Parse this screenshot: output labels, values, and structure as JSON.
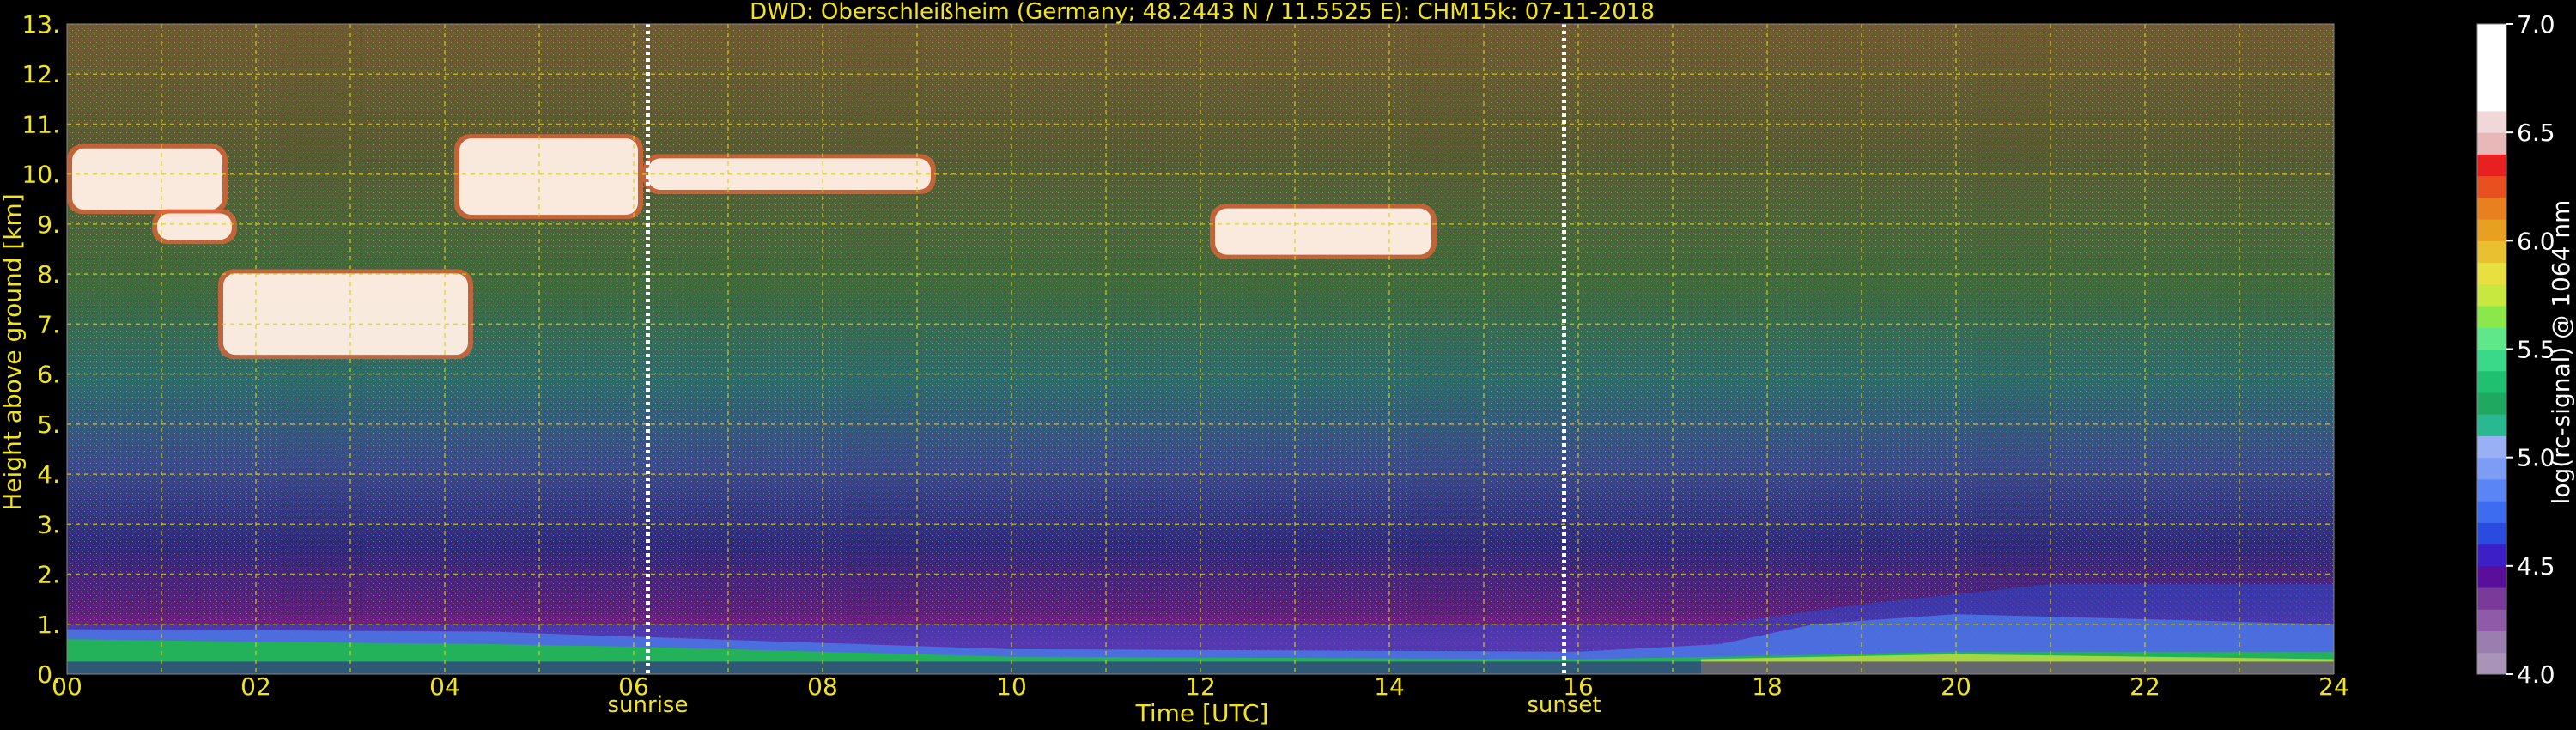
{
  "chart_data": {
    "type": "heatmap",
    "title": "DWD: Oberschleißheim (Germany; 48.2443 N / 11.5525 E):    CHM15k: 07-11-2018",
    "xlabel": "Time [UTC]",
    "ylabel": "Height above ground [km]",
    "xlim": [
      0,
      24
    ],
    "ylim": [
      0,
      13
    ],
    "x_ticks": [
      "00",
      "02",
      "04",
      "06",
      "08",
      "10",
      "12",
      "14",
      "16",
      "18",
      "20",
      "22",
      "24"
    ],
    "y_ticks": [
      "0.",
      "1.",
      "2.",
      "3.",
      "4.",
      "5.",
      "6.",
      "7.",
      "8.",
      "9.",
      "10.",
      "11.",
      "12.",
      "13."
    ],
    "grid": true,
    "events": [
      {
        "label": "sunrise",
        "time": 6.15
      },
      {
        "label": "sunset",
        "time": 15.85
      }
    ],
    "colorbar": {
      "label": "log(rc-signal) @ 1064 nm",
      "range": [
        4.0,
        7.0
      ],
      "ticks": [
        "4.0",
        "4.5",
        "5.0",
        "5.5",
        "6.0",
        "6.5",
        "7.0"
      ]
    },
    "colors": {
      "text": "#f2e31c",
      "background": "#000000",
      "grid": "#d8d020"
    }
  }
}
